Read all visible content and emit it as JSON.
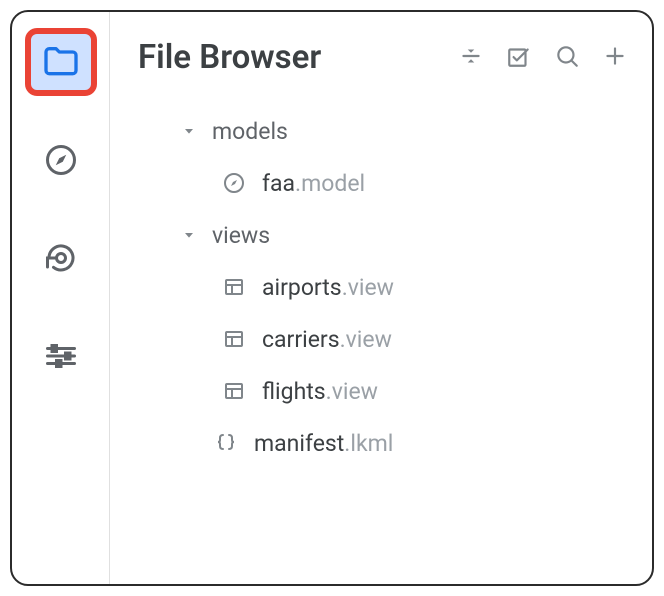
{
  "header": {
    "title": "File Browser"
  },
  "tree": {
    "folders": [
      {
        "label": "models",
        "files": [
          {
            "name": "faa",
            "ext": ".model",
            "icon": "compass"
          }
        ]
      },
      {
        "label": "views",
        "files": [
          {
            "name": "airports",
            "ext": ".view",
            "icon": "table"
          },
          {
            "name": "carriers",
            "ext": ".view",
            "icon": "table"
          },
          {
            "name": "flights",
            "ext": ".view",
            "icon": "table"
          }
        ]
      }
    ],
    "rootFiles": [
      {
        "name": "manifest",
        "ext": ".lkml",
        "icon": "braces"
      }
    ]
  }
}
